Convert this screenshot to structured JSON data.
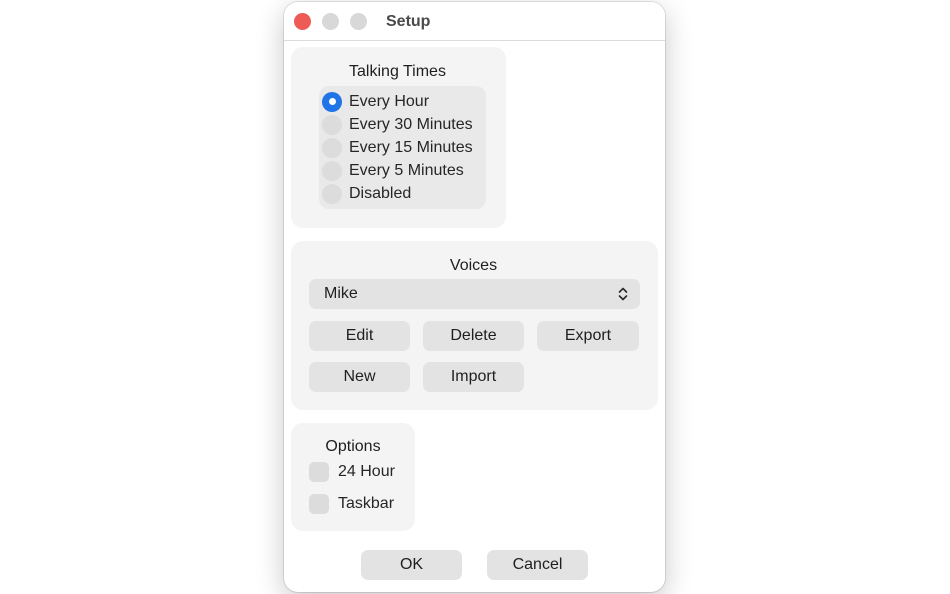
{
  "window": {
    "title": "Setup",
    "controls": {
      "close_color": "#ee5b57",
      "inactive_color": "#d8d8d8"
    }
  },
  "talking_times": {
    "title": "Talking Times",
    "options": [
      {
        "label": "Every Hour",
        "selected": true
      },
      {
        "label": "Every 30 Minutes",
        "selected": false
      },
      {
        "label": "Every 15 Minutes",
        "selected": false
      },
      {
        "label": "Every 5 Minutes",
        "selected": false
      },
      {
        "label": "Disabled",
        "selected": false
      }
    ]
  },
  "voices": {
    "title": "Voices",
    "selected_voice": "Mike",
    "buttons": {
      "edit": "Edit",
      "delete": "Delete",
      "export": "Export",
      "new": "New",
      "import": "Import"
    }
  },
  "options": {
    "title": "Options",
    "items": [
      {
        "label": "24 Hour",
        "checked": false
      },
      {
        "label": "Taskbar",
        "checked": false
      }
    ]
  },
  "footer": {
    "ok": "OK",
    "cancel": "Cancel"
  },
  "colors": {
    "accent": "#1f75e8",
    "panel_bg": "#f4f4f4",
    "button_bg": "#e3e3e3"
  }
}
